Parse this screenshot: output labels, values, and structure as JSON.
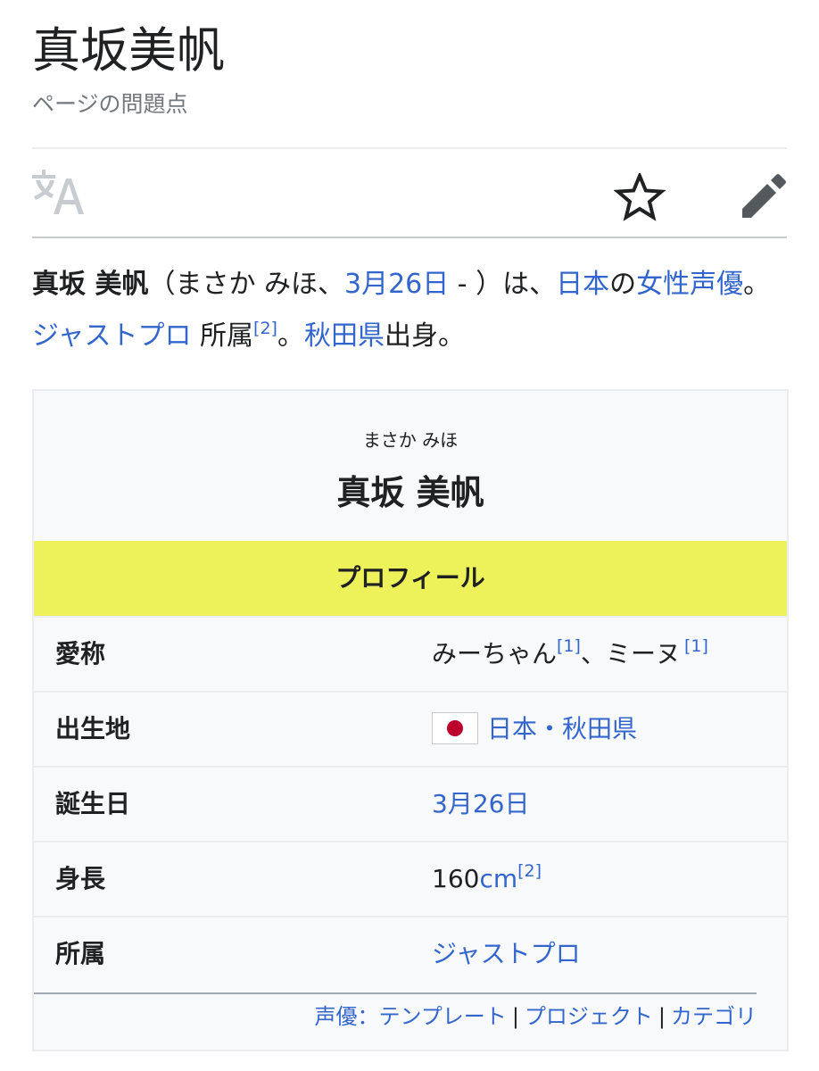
{
  "page": {
    "title": "真坂美帆",
    "issues_link": "ページの問題点"
  },
  "toolbar": {
    "language_icon": "language-icon",
    "watch_icon": "star-icon",
    "edit_icon": "pencil-icon"
  },
  "lead": {
    "name_bold": "真坂 美帆",
    "reading_open": "（まさか みほ、",
    "birthday_link": "3月26日",
    "reading_close": " - ）は、",
    "country_link": "日本",
    "particle_no": "の",
    "job_link": "女性声優",
    "period1": "。",
    "agency_link": "ジャストプロ",
    "affiliation_text": " 所属",
    "ref2": "[2]",
    "period2": "。",
    "pref_link": "秋田県",
    "origin_text": "出身。"
  },
  "infobox": {
    "kana": "まさか みほ",
    "name": "真坂 美帆",
    "section_header": "プロフィール",
    "rows": [
      {
        "label": "愛称",
        "value_a": "みーちゃん",
        "ref_a": "[1]",
        "value_b": "、ミーヌ",
        "ref_b": "[1]"
      },
      {
        "label": "出生地",
        "value_a": "日本・秋田県"
      },
      {
        "label": "誕生日",
        "value_a": "3月26日"
      },
      {
        "label": "身長",
        "value_a": "160",
        "unit": "cm",
        "ref_a": "[2]"
      },
      {
        "label": "所属",
        "value_a": "ジャストプロ"
      }
    ],
    "footer": {
      "prefix": "声優：",
      "template": "テンプレート",
      "separator": "|",
      "project": "プロジェクト",
      "category": "カテゴリ"
    }
  },
  "colors": {
    "link": "#3366cc",
    "header_bg": "#eef25a",
    "infobox_bg": "#f8f9fa"
  }
}
